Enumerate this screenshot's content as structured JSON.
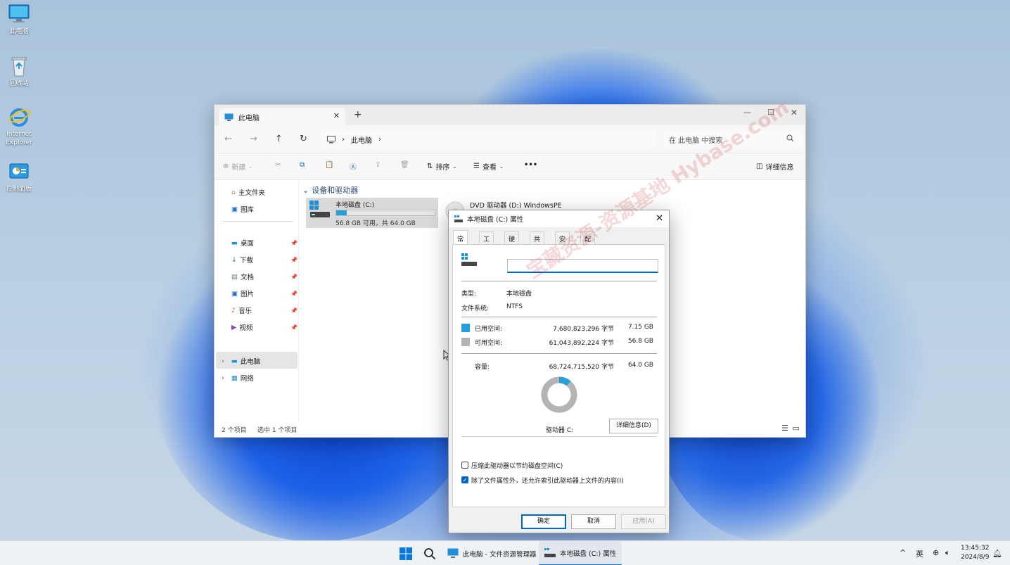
{
  "desktop": {
    "icons": [
      {
        "label": "此电脑",
        "icon": "computer-icon"
      },
      {
        "label": "回收站",
        "icon": "recycle-bin-icon"
      },
      {
        "label": "Internet Explorer",
        "icon": "internet-explorer-icon"
      },
      {
        "label": "控制面板",
        "icon": "control-panel-icon"
      }
    ]
  },
  "explorer": {
    "tab_title": "此电脑",
    "breadcrumb": "此电脑",
    "search_placeholder": "在 此电脑 中搜索",
    "toolbar": {
      "new": "新建",
      "sort": "排序",
      "view": "查看",
      "more": "•••",
      "details": "详细信息"
    },
    "nav": {
      "home": "主文件夹",
      "gallery": "图库",
      "quick": [
        {
          "label": "桌面",
          "icon": "desktop-icon"
        },
        {
          "label": "下载",
          "icon": "download-icon"
        },
        {
          "label": "文档",
          "icon": "document-icon"
        },
        {
          "label": "图片",
          "icon": "pictures-icon"
        },
        {
          "label": "音乐",
          "icon": "music-icon"
        },
        {
          "label": "视频",
          "icon": "video-icon"
        }
      ],
      "this_pc": "此电脑",
      "network": "网络"
    },
    "group_header": "设备和驱动器",
    "drive_c": {
      "name": "本地磁盘 (C:)",
      "space": "56.8 GB 可用，共 64.0 GB",
      "used_fraction": 0.11
    },
    "drive_d": {
      "name": "DVD 驱动器 (D:) WindowsPE"
    },
    "status": {
      "count": "2 个项目",
      "selected": "选中 1 个项目"
    }
  },
  "dialog": {
    "title": "本地磁盘 (C:) 属性",
    "tabs": [
      "常规",
      "工具",
      "硬件",
      "共享",
      "安全",
      "配额"
    ],
    "name_value": "",
    "type_label": "类型:",
    "type_value": "本地磁盘",
    "fs_label": "文件系统:",
    "fs_value": "NTFS",
    "used_label": "已用空间:",
    "used_bytes": "7,680,823,296 字节",
    "used_gb": "7.15 GB",
    "free_label": "可用空间:",
    "free_bytes": "61,043,892,224 字节",
    "free_gb": "56.8 GB",
    "cap_label": "容量:",
    "cap_bytes": "68,724,715,520 字节",
    "cap_gb": "64.0 GB",
    "drive_label": "驱动器 C:",
    "details_button": "详细信息(D)",
    "compress_label": "压缩此驱动器以节约磁盘空间(C)",
    "compress_checked": false,
    "index_label": "除了文件属性外，还允许索引此驱动器上文件的内容(I)",
    "index_checked": true,
    "ok": "确定",
    "cancel": "取消",
    "apply": "应用(A)",
    "used_color": "#26a0da",
    "free_color": "#b4b4b4",
    "used_fraction": 0.112
  },
  "watermark": "宝藏资源-资源基地 Hybase.com",
  "taskbar": {
    "explorer_item": "此电脑 - 文件资源管理器",
    "props_item": "本地磁盘 (C:) 属性",
    "ime": "英",
    "time": "13:45:32",
    "date": "2024/8/9"
  }
}
